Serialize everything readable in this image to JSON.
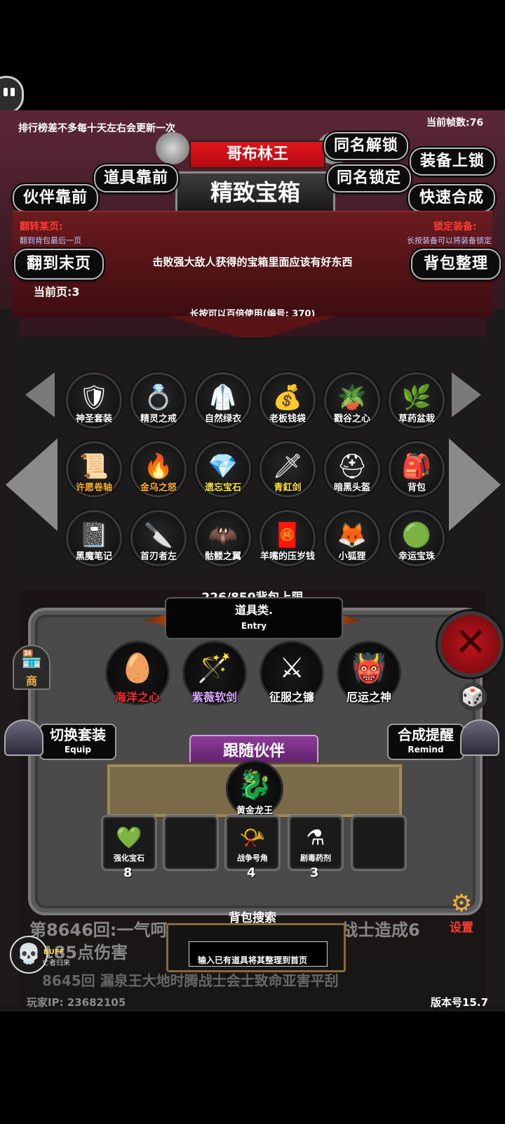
{
  "top": {
    "ranking_note": "排行榜差不多每十天左右会更新一次",
    "fps": "当前帧数:76",
    "boss_name": "哥布林王",
    "chest_title": "精致宝箱"
  },
  "buttons": {
    "same_name_unlock": "同名解锁",
    "equip_lock": "装备上锁",
    "items_front": "道具靠前",
    "same_name_lock": "同名锁定",
    "partner_front": "伙伴靠前",
    "quick_merge": "快速合成",
    "to_last_page": "翻到末页",
    "bag_sort": "背包整理"
  },
  "header": {
    "flip_page_label": "翻转某页:",
    "flip_page_hint": "翻到背包最后一页",
    "lock_equip_label": "锁定装备:",
    "lock_equip_hint": "长按装备可以将装备锁定",
    "description": "击败强大敌人获得的宝箱里面应该有好东西",
    "current_page": "当前页:3",
    "long_press_hint": "长按可以百倍使用(编号: 370)"
  },
  "grid": [
    {
      "name": "神圣套装",
      "icon": "armor-set-icon",
      "glyph": "🛡",
      "color": "white"
    },
    {
      "name": "精灵之戒",
      "icon": "ring-icon",
      "glyph": "💍",
      "color": "white"
    },
    {
      "name": "自然绿衣",
      "icon": "green-robe-icon",
      "glyph": "🥼",
      "color": "white"
    },
    {
      "name": "老板钱袋",
      "icon": "money-bag-icon",
      "glyph": "💰",
      "color": "white"
    },
    {
      "name": "戳谷之心",
      "icon": "heart-icon",
      "glyph": "🪴",
      "color": "white"
    },
    {
      "name": "草药盆栽",
      "icon": "potted-herb-icon",
      "glyph": "🌿",
      "color": "white"
    },
    {
      "name": "许愿卷轴",
      "icon": "scroll-icon",
      "glyph": "📜",
      "color": "orange"
    },
    {
      "name": "金乌之怒",
      "icon": "fire-bird-icon",
      "glyph": "🔥",
      "color": "orange"
    },
    {
      "name": "遗忘宝石",
      "icon": "crystal-icon",
      "glyph": "💎",
      "color": "yellow"
    },
    {
      "name": "青釭剑",
      "icon": "sword-icon",
      "glyph": "🗡",
      "color": "yellow"
    },
    {
      "name": "暗黑头盔",
      "icon": "helmet-icon",
      "glyph": "⛑",
      "color": "white"
    },
    {
      "name": "背包",
      "icon": "backpack-icon",
      "glyph": "🎒",
      "color": "white"
    },
    {
      "name": "黑魔笔记",
      "icon": "notebook-icon",
      "glyph": "📓",
      "color": "white"
    },
    {
      "name": "首刃者左",
      "icon": "blade-icon",
      "glyph": "🔪",
      "color": "white"
    },
    {
      "name": "骷髅之翼",
      "icon": "bone-wings-icon",
      "glyph": "🦇",
      "color": "white"
    },
    {
      "name": "羊嘴的压岁钱",
      "icon": "red-envelope-icon",
      "glyph": "🧧",
      "color": "white"
    },
    {
      "name": "小狐狸",
      "icon": "fox-icon",
      "glyph": "🦊",
      "color": "white"
    },
    {
      "name": "幸运宝珠",
      "icon": "lucky-orb-icon",
      "glyph": "🟢",
      "color": "white"
    }
  ],
  "bag_capacity": "226/850背包上限",
  "entry": {
    "title": "道具类.",
    "subtitle": "Entry"
  },
  "equipped": [
    {
      "name": "海洋之心",
      "icon": "ocean-heart-icon",
      "glyph": "🥚",
      "color": "red"
    },
    {
      "name": "紫薇软剑",
      "icon": "staff-icon",
      "glyph": "🪄",
      "color": "purple"
    },
    {
      "name": "征服之镰",
      "icon": "scythe-icon",
      "glyph": "⚔",
      "color": "white"
    },
    {
      "name": "厄运之神",
      "icon": "red-knight-icon",
      "glyph": "👹",
      "color": "white"
    }
  ],
  "side": {
    "equip_switch": "切换套装",
    "equip_sub": "Equip",
    "remind": "合成提醒",
    "remind_sub": "Remind",
    "shop": "商",
    "settings": "设置"
  },
  "follow": {
    "banner": "跟随伙伴",
    "companion_name": "黄金龙王",
    "companion_icon": "golden-dragon-icon"
  },
  "consumables": [
    {
      "name": "强化宝石",
      "icon": "green-gem-icon",
      "glyph": "💚",
      "count": "8"
    },
    {
      "name": "",
      "icon": "",
      "glyph": "",
      "count": ""
    },
    {
      "name": "战争号角",
      "icon": "war-horn-icon",
      "glyph": "📯",
      "count": "4"
    },
    {
      "name": "剧毒药剂",
      "icon": "poison-flask-icon",
      "glyph": "⚗",
      "count": "3"
    },
    {
      "name": "",
      "icon": "",
      "glyph": "",
      "count": ""
    }
  ],
  "search": {
    "title": "背包搜索",
    "placeholder": "",
    "hint": "输入已有道具将其整理到首页"
  },
  "log": {
    "line1": "第8646回:一气呵",
    "line1b": "战士造成6",
    "line2": "185点伤害",
    "line3": "8645回 漏泉王大地时腾战士会士致命亚害平刮"
  },
  "footer": {
    "buff_label": "BUFF",
    "buff_sub": "亡者归来",
    "player_ip": "玩家IP: 23682105",
    "version": "版本号15.7"
  }
}
